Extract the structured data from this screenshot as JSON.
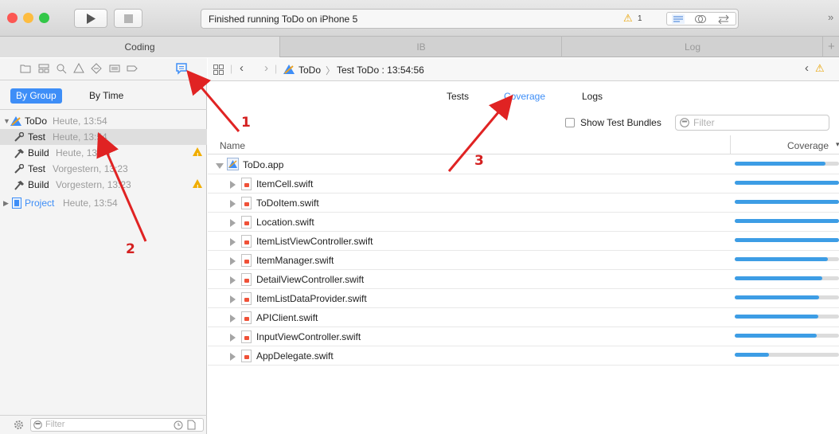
{
  "toolbar": {
    "run_icon": "play-icon",
    "stop_icon": "stop-icon",
    "status_text": "Finished running ToDo on iPhone 5",
    "warning_count": "1",
    "colors": {
      "close": "#fc5753",
      "minimize": "#fdbc40",
      "zoom": "#33c748"
    }
  },
  "tabs": [
    {
      "label": "Coding",
      "active": true
    },
    {
      "label": "IB",
      "active": false
    },
    {
      "label": "Log",
      "active": false
    }
  ],
  "navigator": {
    "scope": {
      "by_group": "By Group",
      "by_time": "By Time"
    },
    "items": [
      {
        "icon": "xcode-target-icon",
        "name": "ToDo",
        "meta": "Heute, 13:54",
        "warning": false
      },
      {
        "icon": "test-wrench-icon",
        "name": "Test",
        "meta": "Heute, 13:54",
        "warning": false
      },
      {
        "icon": "build-hammer-icon",
        "name": "Build",
        "meta": "Heute, 13:54",
        "warning": true
      },
      {
        "icon": "test-wrench-icon",
        "name": "Test",
        "meta": "Vorgestern, 13:23",
        "warning": false
      },
      {
        "icon": "build-hammer-icon",
        "name": "Build",
        "meta": "Vorgestern, 13:23",
        "warning": true
      },
      {
        "icon": "project-icon",
        "name": "Project",
        "meta": "Heute, 13:54",
        "warning": false
      }
    ],
    "filter_placeholder": "Filter"
  },
  "jumpbar": {
    "crumb1": "ToDo",
    "crumb2": "Test ToDo : 13:54:56"
  },
  "report_tabs": {
    "tests": "Tests",
    "coverage": "Coverage",
    "logs": "Logs"
  },
  "options": {
    "show_test_bundles": "Show Test Bundles",
    "filter_placeholder": "Filter"
  },
  "table": {
    "col_name": "Name",
    "col_coverage": "Coverage",
    "root": {
      "name": "ToDo.app",
      "coverage": 0.87
    },
    "files": [
      {
        "name": "ItemCell.swift",
        "coverage": 1.0
      },
      {
        "name": "ToDoItem.swift",
        "coverage": 1.0
      },
      {
        "name": "Location.swift",
        "coverage": 1.0
      },
      {
        "name": "ItemListViewController.swift",
        "coverage": 1.0
      },
      {
        "name": "ItemManager.swift",
        "coverage": 0.89
      },
      {
        "name": "DetailViewController.swift",
        "coverage": 0.84
      },
      {
        "name": "ItemListDataProvider.swift",
        "coverage": 0.81
      },
      {
        "name": "APIClient.swift",
        "coverage": 0.8
      },
      {
        "name": "InputViewController.swift",
        "coverage": 0.79
      },
      {
        "name": "AppDelegate.swift",
        "coverage": 0.33
      }
    ]
  },
  "annotations": {
    "one": "1",
    "two": "2",
    "three": "3"
  }
}
